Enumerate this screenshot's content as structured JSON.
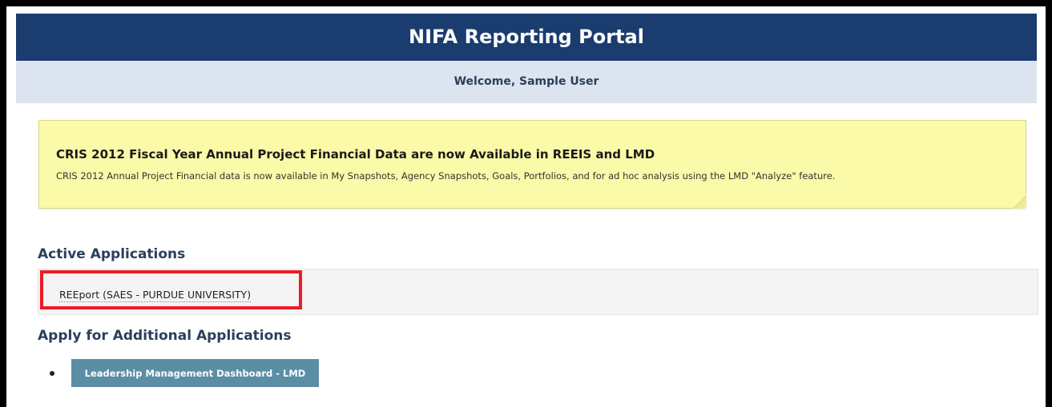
{
  "header": {
    "title": "NIFA Reporting Portal",
    "welcome": "Welcome, Sample User"
  },
  "notice": {
    "title": "CRIS 2012 Fiscal Year Annual Project Financial Data are now Available in REEIS and LMD",
    "body": "CRIS 2012 Annual Project Financial data is now available in My Snapshots, Agency Snapshots, Goals, Portfolios, and for ad hoc analysis using the LMD \"Analyze\" feature."
  },
  "active_applications": {
    "heading": "Active Applications",
    "items": [
      {
        "label": "REEport (SAES - PURDUE UNIVERSITY)"
      }
    ]
  },
  "additional_applications": {
    "heading": "Apply for Additional Applications",
    "items": [
      {
        "label": "Leadership Management Dashboard - LMD"
      }
    ]
  },
  "colors": {
    "header_bg": "#1a3c6e",
    "welcome_bg": "#dce4ef",
    "notice_bg": "#fbfaa8",
    "button_bg": "#5a8ea5",
    "highlight": "#ee1c24"
  }
}
